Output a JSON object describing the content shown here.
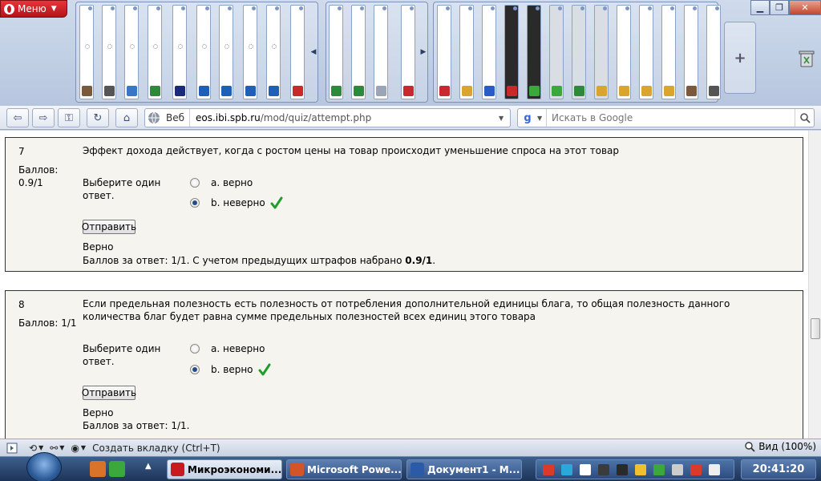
{
  "browser": {
    "menu_label": "Меню",
    "address": {
      "mode_label": "Веб",
      "url_host": "eos.ibi.spb.ru",
      "url_path": "/mod/quiz/attempt.php"
    },
    "search": {
      "placeholder": "Искать в Google"
    },
    "status": {
      "new_tab_label": "Создать вкладку (Ctrl+T)",
      "zoom_label": "Вид (100%)"
    }
  },
  "quiz": {
    "questions": [
      {
        "number": "7",
        "score_label": "Баллов:",
        "score_value": "0.9/1",
        "text": "Эффект дохода действует, когда с ростом цены на товар происходит уменьшение спроса на этот товар",
        "prompt_line1": "Выберите один",
        "prompt_line2": "ответ.",
        "options": [
          {
            "label": "a. верно",
            "selected": false,
            "correct_mark": false
          },
          {
            "label": "b. неверно",
            "selected": true,
            "correct_mark": true
          }
        ],
        "submit_label": "Отправить",
        "feedback_status": "Верно",
        "feedback_detail": "Баллов за ответ: 1/1. С учетом предыдущих штрафов набрано ",
        "feedback_total": "0.9/1",
        "feedback_end": "."
      },
      {
        "number": "8",
        "score_label": "Баллов: 1/1",
        "text": "Если предельная полезность есть полезность от потребления дополнительной единицы блага, то общая полезность данного количества благ будет равна сумме предельных полезностей всех единиц этого товара",
        "prompt_line1": "Выберите один",
        "prompt_line2": "ответ.",
        "options": [
          {
            "label": "a. неверно",
            "selected": false,
            "correct_mark": false
          },
          {
            "label": "b. верно",
            "selected": true,
            "correct_mark": true
          }
        ],
        "submit_label": "Отправить",
        "feedback_status": "Верно",
        "feedback_detail": "Баллов за ответ: 1/1."
      }
    ]
  },
  "taskbar": {
    "tasks": [
      {
        "label": "Микроэкономи...",
        "active": true,
        "icon": "opera-icon"
      },
      {
        "label": "Microsoft Powe...",
        "active": false,
        "icon": "powerpoint-icon"
      },
      {
        "label": "Документ1 - M...",
        "active": false,
        "icon": "word-icon"
      }
    ],
    "clock": "20:41:20"
  },
  "colors": {
    "accent_red": "#c81a20",
    "check_green": "#1e9e2a",
    "taskbar_blue": "#2a4a7a"
  }
}
